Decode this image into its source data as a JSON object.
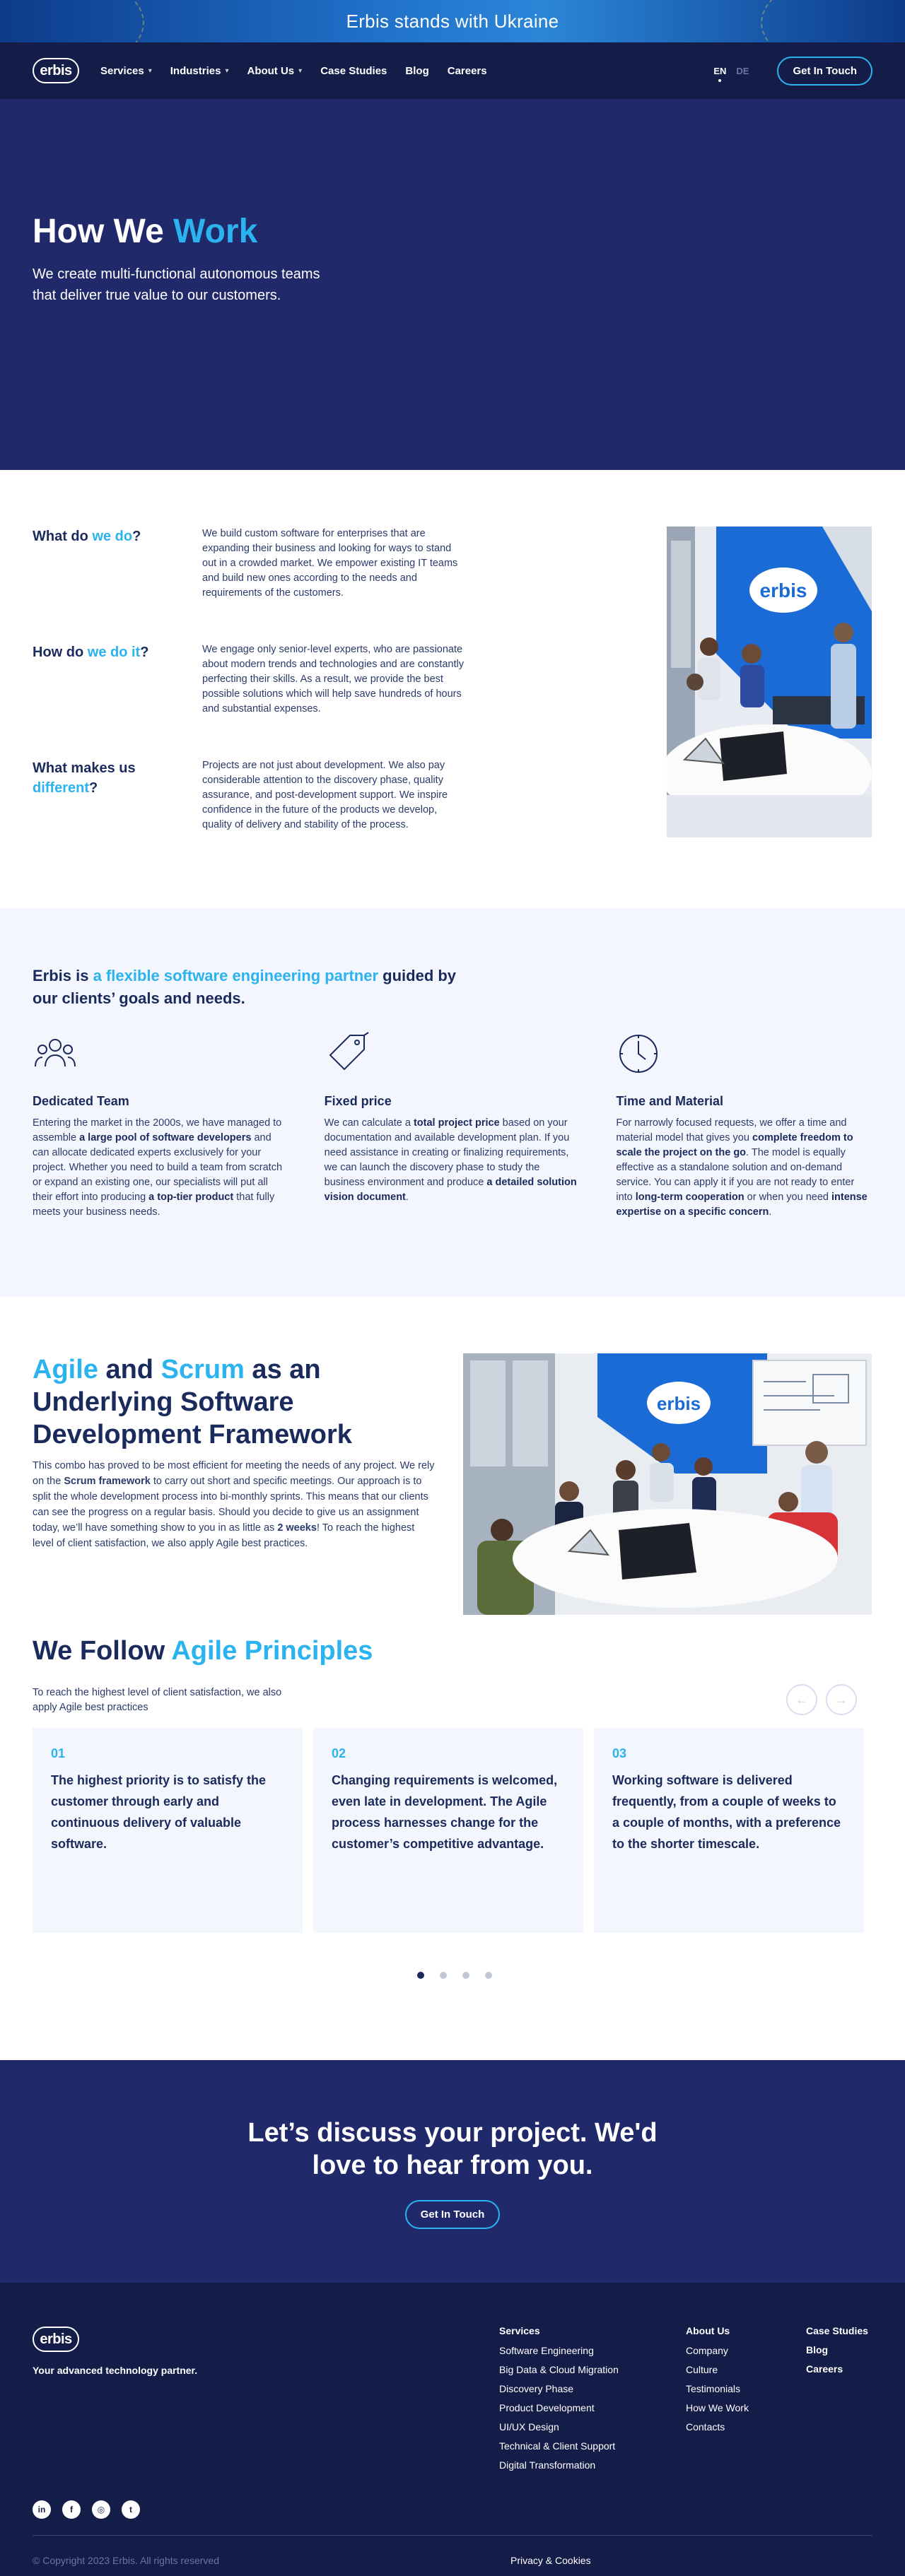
{
  "banner": {
    "text": "Erbis stands with Ukraine"
  },
  "nav": {
    "logo": "erbis",
    "items": [
      "Services",
      "Industries",
      "About Us",
      "Case Studies",
      "Blog",
      "Careers"
    ],
    "dropdown_flags": [
      true,
      true,
      true,
      false,
      false,
      false
    ],
    "lang_active": "EN",
    "lang_inactive": "DE",
    "cta": "Get In Touch"
  },
  "hero": {
    "title_a": "How We ",
    "title_b": "Work",
    "subtitle": "We create multi-functional autonomous teams that deliver true value to our customers."
  },
  "what": {
    "items": [
      {
        "title_a": "What do ",
        "title_b": "we do",
        "title_c": "?",
        "body": "We build custom software for enterprises that are expanding their business and looking for ways to stand out in a crowded market. We empower existing IT teams and build new ones according to the needs and requirements of the customers."
      },
      {
        "title_a": "How do ",
        "title_b": "we do it",
        "title_c": "?",
        "body": "We engage only senior-level experts, who are passionate about modern trends and technologies and are constantly perfecting their skills. As a result, we provide the best possible solutions which will help save hundreds of hours and substantial expenses."
      },
      {
        "title_a": "What makes us ",
        "title_b": "different",
        "title_c": "?",
        "body": "Projects are not just about development. We also pay considerable attention to the discovery phase, quality assurance, and post-development support. We inspire confidence in the future of the products we develop, quality of delivery and stability of the process."
      }
    ],
    "photo_logo": "erbis"
  },
  "partner": {
    "title_a": "Erbis is ",
    "title_b": "a flexible software engineering partner",
    "title_c": " guided by our clients’ goals and needs.",
    "models": [
      {
        "icon": "team-icon",
        "title": "Dedicated Team",
        "p1": "Entering the market in the 2000s, we have managed to assemble ",
        "b1": "a large pool of software developers",
        "p2": " and can allocate dedicated experts exclusively for your project. Whether you need to build a team from scratch or expand an existing one, our specialists will put all their effort into producing ",
        "b2": "a top-tier product",
        "p3": " that fully meets your business needs."
      },
      {
        "icon": "price-tag-icon",
        "title": "Fixed price",
        "p1": "We can calculate a ",
        "b1": "total project price",
        "p2": " based on your documentation and available development plan. If you need assistance in creating or finalizing requirements, we can launch the discovery phase to study the business environment and produce ",
        "b2": "a detailed solution vision document",
        "p3": "."
      },
      {
        "icon": "clock-icon",
        "title": "Time and Material",
        "p1": "For narrowly focused requests, we offer a time and material model that gives you ",
        "b1": "complete freedom to scale the project on the go",
        "p2": ". The model is equally effective as a standalone solution and on-demand service. You can apply it if you are not ready to enter into ",
        "b2": "long-term cooperation",
        "p3": " or when you need ",
        "b3": "intense expertise on a specific concern",
        "p4": "."
      }
    ]
  },
  "agile": {
    "title_a": "Agile",
    "title_b": " and ",
    "title_c": "Scrum",
    "title_d": " as an Underlying Software Development Framework",
    "p1": "This combo has proved to be most efficient for meeting the needs of any project. We rely on the ",
    "b1": "Scrum framework",
    "p2": " to carry out short and specific meetings. Our approach is to split the whole development process into bi-monthly sprints. This means that our clients can see the progress on a regular basis. Should you decide to give us an assignment today, we’ll have something show to you in as little as ",
    "b2": "2 weeks",
    "p3": "! To reach the highest level of client satisfaction, we also apply Agile best practices.",
    "photo_logo": "erbis"
  },
  "principles": {
    "title_a": "We Follow ",
    "title_b": "Agile Principles",
    "subtitle": "To reach the highest level of client satisfaction, we also apply Agile best practices",
    "prev": "←",
    "next": "→",
    "cards": [
      {
        "num": "01",
        "text": "The highest priority is to satisfy the customer through early and continuous delivery of valuable software."
      },
      {
        "num": "02",
        "text": "Changing requirements is welcomed, even late in development. The Agile process harnesses change for the customer’s competitive advantage."
      },
      {
        "num": "03",
        "text": "Working software is delivered frequently, from a couple of weeks to a couple of months, with a preference to the shorter timescale."
      }
    ],
    "active_page": 1
  },
  "cta": {
    "title": "Let’s discuss your project. We'd love to hear from you.",
    "button": "Get In Touch"
  },
  "footer": {
    "logo": "erbis",
    "tagline": "Your advanced technology partner.",
    "services_title": "Services",
    "services": [
      "Software Engineering",
      "Big Data & Cloud Migration",
      "Discovery Phase",
      "Product Development",
      "UI/UX Design",
      "Technical & Client Support",
      "Digital Transformation"
    ],
    "about_title": "About Us",
    "about": [
      "Company",
      "Culture",
      "Testimonials",
      "How We Work",
      "Contacts"
    ],
    "extra": [
      "Case Studies",
      "Blog",
      "Careers"
    ],
    "social": [
      "in",
      "f",
      "◎",
      "t"
    ],
    "copyright": "© Copyright 2023 Erbis. All rights reserved",
    "privacy": "Privacy & Cookies"
  },
  "colors": {
    "navy": "#141c48",
    "hero": "#20296a",
    "accent": "#2bb3f0",
    "text": "#1b2a5c",
    "light_bg": "#f3f6fd"
  }
}
